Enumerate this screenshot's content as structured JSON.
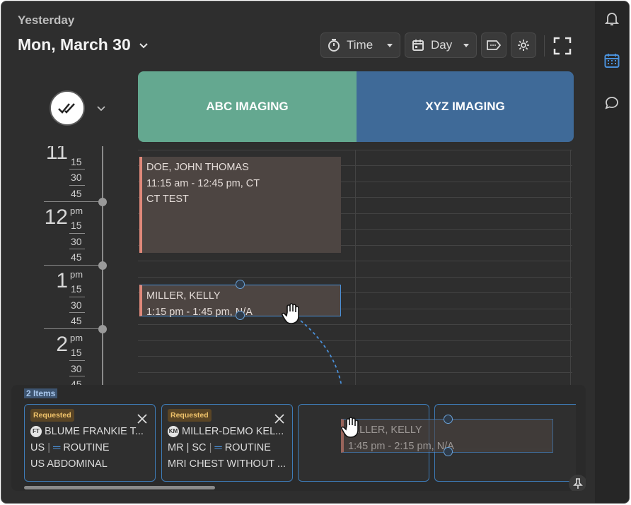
{
  "header": {
    "day_label": "Yesterday",
    "date": "Mon, March 30"
  },
  "toolbar": {
    "time_label": "Time",
    "day_label": "Day"
  },
  "resources": [
    {
      "name": "ABC IMAGING",
      "color": "#64a890"
    },
    {
      "name": "XYZ IMAGING",
      "color": "#3f6a98"
    }
  ],
  "timeline": {
    "hours": [
      {
        "hour": "11",
        "ampm": ""
      },
      {
        "hour": "12",
        "ampm": "pm"
      },
      {
        "hour": "1",
        "ampm": "pm"
      },
      {
        "hour": "2",
        "ampm": "pm"
      }
    ],
    "quarters": [
      "15",
      "30",
      "45"
    ]
  },
  "events": [
    {
      "name": "DOE, JOHN THOMAS",
      "time": "11:15 am - 12:45 pm, CT",
      "desc": "CT TEST"
    },
    {
      "name": "MILLER, KELLY",
      "time": "1:15 pm - 1:45 pm, N/A"
    }
  ],
  "tray": {
    "count_label": "2 Items",
    "cards": [
      {
        "status": "Requested",
        "initials": "FT",
        "name": "BLUME FRANKIE T...",
        "modality": "US",
        "priority": "ROUTINE",
        "procedure": "US ABDOMINAL"
      },
      {
        "status": "Requested",
        "initials": "KM",
        "name": "MILLER-DEMO KEL...",
        "modality": "MR | SC",
        "priority": "ROUTINE",
        "procedure": "MRI CHEST WITHOUT ..."
      }
    ],
    "drag_ghost": {
      "name": "MILLER, KELLY",
      "time": "1:45 pm - 2:15 pm, N/A"
    }
  }
}
